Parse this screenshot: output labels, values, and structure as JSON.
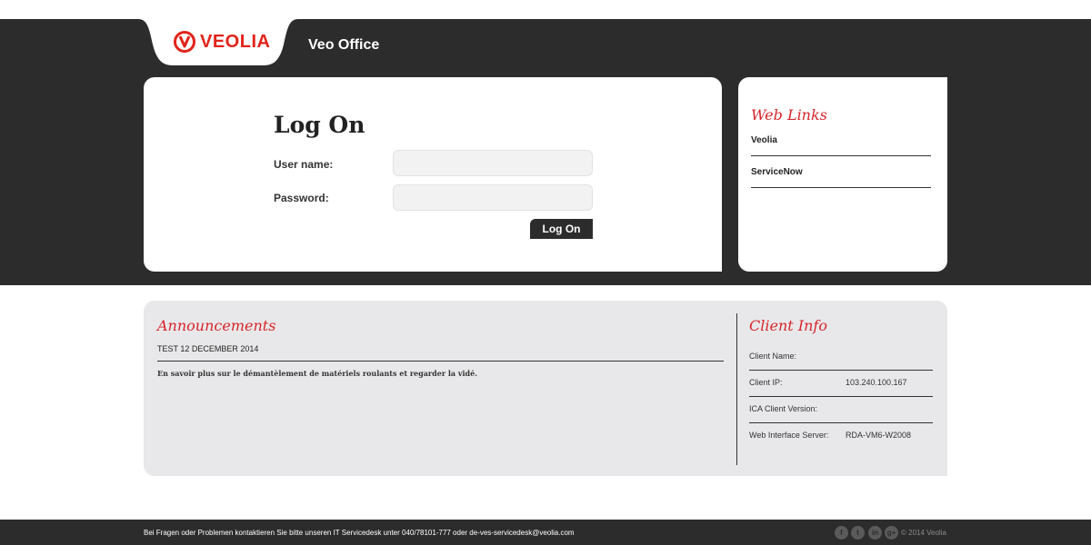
{
  "header": {
    "logo_text": "VEOLIA",
    "app_title": "Veo Office",
    "brand_color": "#e2231a"
  },
  "login": {
    "title": "Log On",
    "username_label": "User name:",
    "username_value": "",
    "password_label": "Password:",
    "password_value": "",
    "button_label": "Log On"
  },
  "weblinks": {
    "heading": "Web Links",
    "items": [
      {
        "label": "Veolia"
      },
      {
        "label": "ServiceNow"
      }
    ]
  },
  "announcements": {
    "heading": "Announcements",
    "date": "TEST 12 DECEMBER 2014",
    "body": "En savoir plus sur le démantèlement de matériels roulants et regarder la vidé."
  },
  "client_info": {
    "heading": "Client Info",
    "rows": [
      {
        "label": "Client Name:",
        "value": ""
      },
      {
        "label": "Client IP:",
        "value": "103.240.100.167"
      },
      {
        "label": "ICA Client Version:",
        "value": ""
      },
      {
        "label": "Web Interface Server:",
        "value": "RDA-VM6-W2008"
      }
    ]
  },
  "footer": {
    "text": "Bei Fragen oder Problemen kontaktieren Sie bitte unseren IT Servicedesk unter 040/78101-777 oder de-ves-servicedesk@veolia.com",
    "social": [
      {
        "icon": "facebook-icon",
        "glyph": "f"
      },
      {
        "icon": "twitter-icon",
        "glyph": "t"
      },
      {
        "icon": "linkedin-icon",
        "glyph": "in"
      },
      {
        "icon": "googleplus-icon",
        "glyph": "g+"
      }
    ],
    "copyright": "© 2014 Veolia"
  }
}
